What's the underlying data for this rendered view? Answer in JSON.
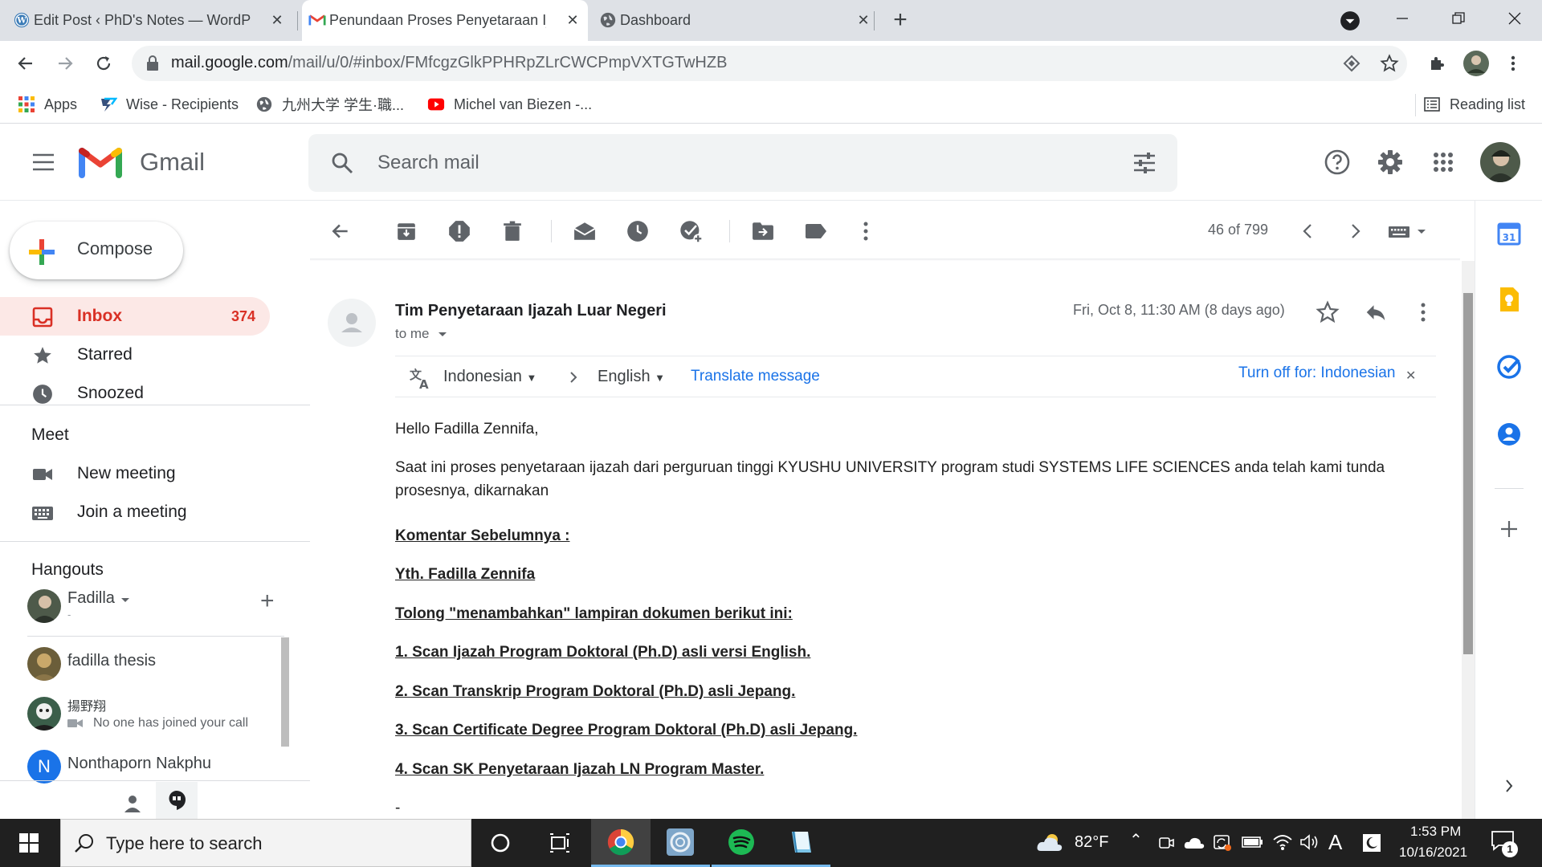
{
  "browser": {
    "tabs": [
      {
        "title": "Edit Post ‹ PhD's Notes — WordPress",
        "icon": "wordpress-icon"
      },
      {
        "title": "Penundaan Proses Penyetaraan Ijazah",
        "icon": "gmail-icon"
      },
      {
        "title": "Dashboard",
        "icon": "globe-icon"
      }
    ],
    "url_host": "mail.google.com",
    "url_path": "/mail/u/0/#inbox/FMfcgzGlkPPHRpZLrCWCPmpVXTGTwHZB",
    "bookmarks": [
      "Apps",
      "Wise - Recipients",
      "九州大学 学生·職...",
      "Michel van Biezen -..."
    ],
    "reading_list": "Reading list"
  },
  "gmail": {
    "logo_text": "Gmail",
    "search_placeholder": "Search mail",
    "compose": "Compose",
    "nav": [
      {
        "label": "Inbox",
        "count": "374"
      },
      {
        "label": "Starred"
      },
      {
        "label": "Snoozed"
      }
    ],
    "meet": {
      "title": "Meet",
      "items": [
        "New meeting",
        "Join a meeting"
      ]
    },
    "hangouts": {
      "title": "Hangouts",
      "me": "Fadilla",
      "me_status": "-",
      "contacts": [
        {
          "name": "fadilla thesis"
        },
        {
          "name": "揚野翔",
          "status": "No one has joined your call"
        },
        {
          "name": "Nonthaporn Nakphu",
          "initial": "N"
        }
      ]
    },
    "pagination": "46 of 799"
  },
  "email": {
    "sender": "Tim Penyetaraan Ijazah Luar Negeri",
    "to": "to me",
    "date": "Fri, Oct 8, 11:30 AM (8 days ago)",
    "translate": {
      "from": "Indonesian",
      "to": "English",
      "action": "Translate message",
      "turn_off": "Turn off for: Indonesian"
    },
    "greeting": "Hello Fadilla Zennifa,",
    "intro": "Saat ini proses penyetaraan ijazah dari perguruan tinggi KYUSHU UNIVERSITY program studi SYSTEMS LIFE SCIENCES anda telah kami tunda prosesnya, dikarnakan",
    "lines": [
      "Komentar Sebelumnya :",
      "Yth. Fadilla Zennifa",
      "Tolong \"menambahkan\" lampiran dokumen berikut ini:",
      "1. Scan Ijazah Program Doktoral (Ph.D) asli versi English.",
      "2. Scan Transkrip Program Doktoral (Ph.D) asli Jepang.",
      "3. Scan Certificate Degree Program Doktoral (Ph.D) asli Jepang.",
      "4. Scan SK Penyetaraan Ijazah LN Program Master."
    ],
    "trailing": "-"
  },
  "taskbar": {
    "search_placeholder": "Type here to search",
    "weather": "82°F",
    "time": "1:53 PM",
    "date": "10/16/2021",
    "notifications": "1",
    "ime": "A"
  },
  "colors": {
    "gmail_red": "#d93025",
    "link_blue": "#1a73e8",
    "inbox_bg": "#fce8e6"
  }
}
